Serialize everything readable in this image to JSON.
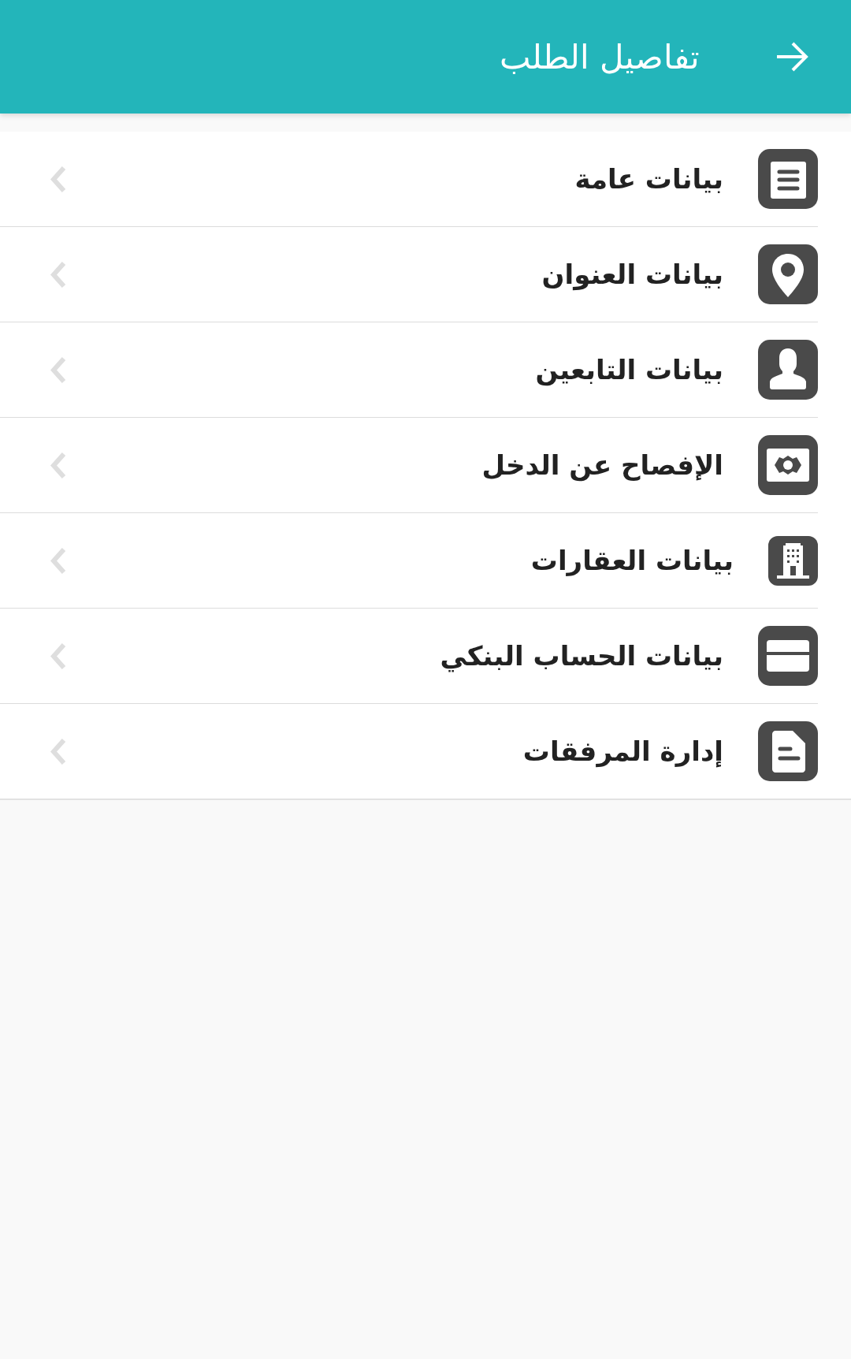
{
  "header": {
    "title": "تفاصيل الطلب"
  },
  "menu": {
    "items": [
      {
        "label": "بيانات عامة",
        "kind": "document"
      },
      {
        "label": "بيانات العنوان",
        "kind": "location"
      },
      {
        "label": "بيانات التابعين",
        "kind": "person"
      },
      {
        "label": "الإفصاح عن الدخل",
        "kind": "money"
      },
      {
        "label": "بيانات العقارات",
        "kind": "building"
      },
      {
        "label": "بيانات الحساب البنكي",
        "kind": "card"
      },
      {
        "label": "إدارة المرفقات",
        "kind": "file"
      }
    ]
  }
}
